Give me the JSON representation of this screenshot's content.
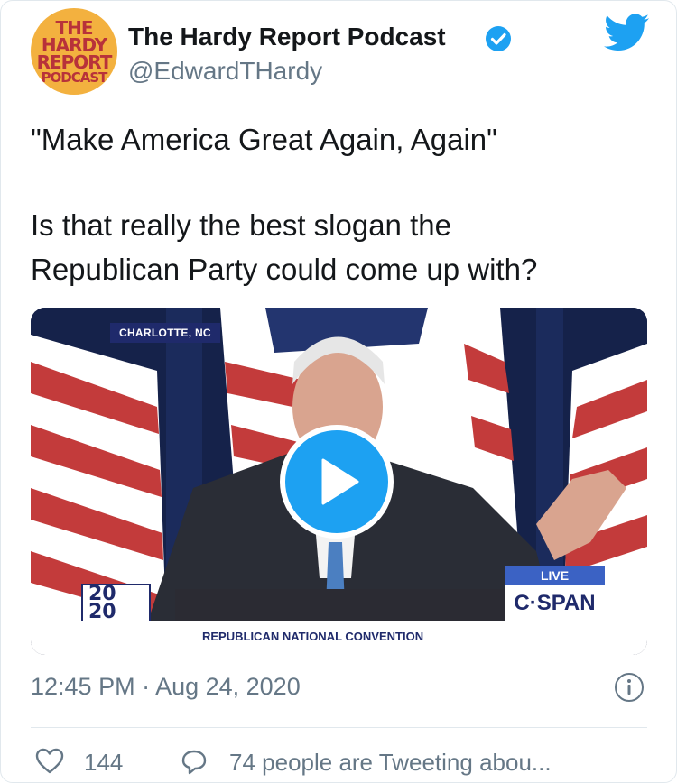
{
  "author": {
    "name": "The Hardy Report Podcast",
    "handle": "@EdwardTHardy",
    "avatar_lines": [
      "THE",
      "HARDY",
      "REPORT",
      "PODCAST"
    ]
  },
  "tweet": {
    "lines": [
      "\"Make America Great Again, Again\"",
      "Is that really the best slogan the",
      "Republican Party could come up with?"
    ]
  },
  "video": {
    "location": "CHARLOTTE, NC",
    "banner": "REPUBLICAN NATIONAL CONVENTION",
    "logo": [
      "20",
      "20"
    ],
    "live": "LIVE",
    "network": "C·SPAN"
  },
  "meta": {
    "timestamp": "12:45 PM · Aug 24, 2020"
  },
  "actions": {
    "likes": "144",
    "tweeting": "74 people are Tweeting abou..."
  },
  "colors": {
    "accent": "#1da1f2",
    "muted": "#657786",
    "text": "#14171a"
  }
}
